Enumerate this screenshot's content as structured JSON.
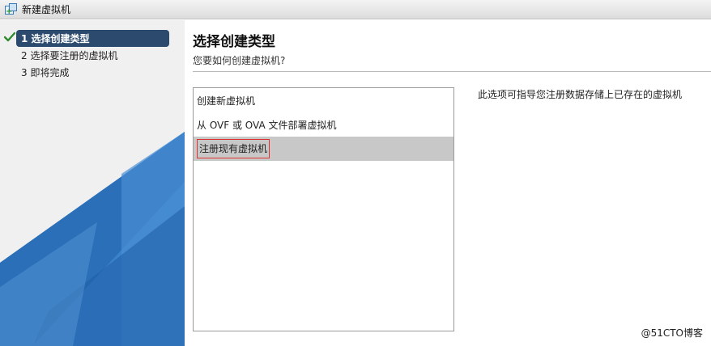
{
  "window": {
    "title": "新建虚拟机",
    "icon": "new-vm-icon"
  },
  "steps": [
    {
      "label": "1 选择创建类型",
      "active": true,
      "completed": true
    },
    {
      "label": "2 选择要注册的虚拟机",
      "active": false,
      "completed": false
    },
    {
      "label": "3 即将完成",
      "active": false,
      "completed": false
    }
  ],
  "main": {
    "title": "选择创建类型",
    "subtitle": "您要如何创建虚拟机?",
    "options": [
      {
        "label": "创建新虚拟机",
        "selected": false
      },
      {
        "label": "从 OVF 或 OVA 文件部署虚拟机",
        "selected": false
      },
      {
        "label": "注册现有虚拟机",
        "selected": true
      }
    ],
    "description": "此选项可指导您注册数据存储上已存在的虚拟机"
  },
  "watermark": "@51CTO博客",
  "colors": {
    "active_step_bg": "#2c4a6e",
    "selected_row_bg": "#c8c8c8",
    "highlight_border": "#e03030",
    "sidebar_bg": "#f0f0f0",
    "sidebar_art_dark": "#2a6fb8",
    "sidebar_art_light": "#4a8fd4",
    "check": "#2e8b2e"
  }
}
